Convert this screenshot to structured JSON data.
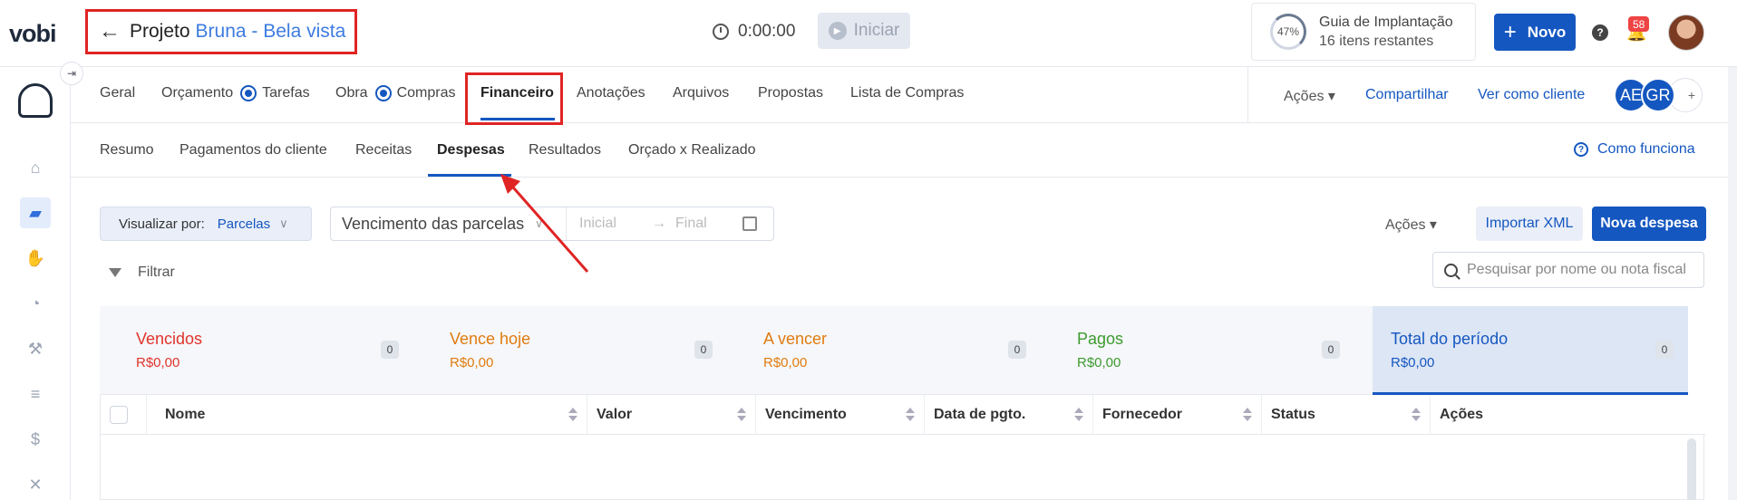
{
  "header": {
    "logo": "vobi",
    "project_prefix": "Projeto",
    "project_name": "Bruna - Bela vista",
    "timer": "0:00:00",
    "start_label": "Iniciar",
    "guide_percent": "47%",
    "guide_title": "Guia de Implantação",
    "guide_subtitle": "16 itens restantes",
    "new_label": "Novo",
    "help_label": "?",
    "notifications": "58"
  },
  "tabs": [
    {
      "label": "Geral"
    },
    {
      "label": "Orçamento"
    },
    {
      "label": "Tarefas"
    },
    {
      "label": "Obra"
    },
    {
      "label": "Compras"
    },
    {
      "label": "Financeiro"
    },
    {
      "label": "Anotações"
    },
    {
      "label": "Arquivos"
    },
    {
      "label": "Propostas"
    },
    {
      "label": "Lista de Compras"
    }
  ],
  "tabs_right": {
    "actions": "Ações",
    "share": "Compartilhar",
    "view_as_client": "Ver como cliente",
    "avatars": [
      "AE",
      "GR"
    ],
    "add": "+"
  },
  "subtabs": [
    {
      "label": "Resumo"
    },
    {
      "label": "Pagamentos do cliente"
    },
    {
      "label": "Receitas"
    },
    {
      "label": "Despesas"
    },
    {
      "label": "Resultados"
    },
    {
      "label": "Orçado x Realizado"
    }
  ],
  "how_it_works": "Como funciona",
  "controls": {
    "view_by_label": "Visualizar por:",
    "view_by_value": "Parcelas",
    "date_select": "Vencimento das parcelas",
    "date_start_placeholder": "Inicial",
    "date_end_placeholder": "Final",
    "actions": "Ações",
    "import_xml": "Importar XML",
    "new_expense": "Nova despesa",
    "filter": "Filtrar",
    "search_placeholder": "Pesquisar por nome ou nota fiscal"
  },
  "summary": [
    {
      "title": "Vencidos",
      "amount": "R$0,00",
      "count": "0",
      "color": "#e0342b"
    },
    {
      "title": "Vence hoje",
      "amount": "R$0,00",
      "count": "0",
      "color": "#e07b10"
    },
    {
      "title": "A vencer",
      "amount": "R$0,00",
      "count": "0",
      "color": "#e07b10"
    },
    {
      "title": "Pagos",
      "amount": "R$0,00",
      "count": "0",
      "color": "#3c9a2f"
    },
    {
      "title": "Total do período",
      "amount": "R$0,00",
      "count": "0",
      "color": "#1557c0"
    }
  ],
  "table": {
    "columns": [
      "Nome",
      "Valor",
      "Vencimento",
      "Data de pgto.",
      "Fornecedor",
      "Status",
      "Ações"
    ]
  },
  "colors": {
    "primary": "#1557c0",
    "annotation_red": "#e02424"
  }
}
